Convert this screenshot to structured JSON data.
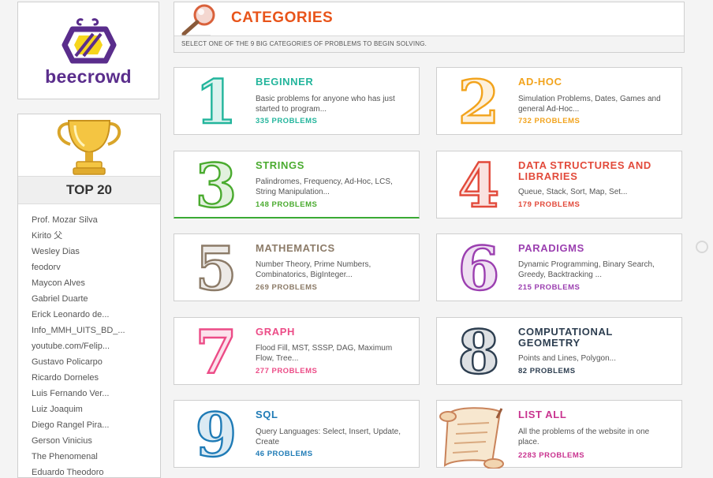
{
  "brand": {
    "name": "beecrowd"
  },
  "ranking": {
    "title": "TOP 20",
    "users": [
      "Prof. Mozar Silva",
      "Kirito 父",
      "Wesley Dias",
      "feodorv",
      "Maycon Alves",
      "Gabriel Duarte",
      "Erick Leonardo de...",
      "Info_MMH_UITS_BD_...",
      "youtube.com/Felip...",
      "Gustavo Policarpo",
      "Ricardo Dorneles",
      "Luis Fernando Ver...",
      "Luiz Joaquim",
      "Diego Rangel Pira...",
      "Gerson Vinicius",
      "The Phenomenal",
      "Eduardo Theodoro"
    ]
  },
  "header": {
    "title": "CATEGORIES",
    "subtitle": "Select one of the 9 big categories of problems to begin solving."
  },
  "categories": [
    {
      "number": "1",
      "name": "Beginner",
      "description": "Basic problems for anyone who has just started to program...",
      "count": "335 problems",
      "color": "#23b59c"
    },
    {
      "number": "2",
      "name": "Ad-Hoc",
      "description": "Simulation Problems, Dates, Games and general Ad-Hoc...",
      "count": "732 problems",
      "color": "#f2a31c"
    },
    {
      "number": "3",
      "name": "Strings",
      "description": "Palindromes, Frequency, Ad-Hoc, LCS, String Manipulation...",
      "count": "148 problems",
      "color": "#4aab2f"
    },
    {
      "number": "4",
      "name": "Data Structures and Libraries",
      "description": "Queue, Stack, Sort, Map, Set...",
      "count": "179 problems",
      "color": "#e24a3b"
    },
    {
      "number": "5",
      "name": "Mathematics",
      "description": "Number Theory, Prime Numbers, Combinatorics, BigInteger...",
      "count": "269 problems",
      "color": "#8c7b68"
    },
    {
      "number": "6",
      "name": "Paradigms",
      "description": "Dynamic Programming, Binary Search, Greedy, Backtracking ...",
      "count": "215 problems",
      "color": "#9b3fb0"
    },
    {
      "number": "7",
      "name": "Graph",
      "description": "Flood Fill, MST, SSSP, DAG, Maximum Flow, Tree...",
      "count": "277 problems",
      "color": "#ec4c87"
    },
    {
      "number": "8",
      "name": "Computational Geometry",
      "description": "Points and Lines, Polygon...",
      "count": "82 problems",
      "color": "#2d3e50"
    },
    {
      "number": "9",
      "name": "SQL",
      "description": "Query Languages: Select, Insert, Update, Create",
      "count": "46 problems",
      "color": "#1f7bb6"
    },
    {
      "number": "",
      "name": "List All",
      "description": "All the problems of the website in one place.",
      "count": "2283 problems",
      "color": "#c9338f"
    }
  ]
}
